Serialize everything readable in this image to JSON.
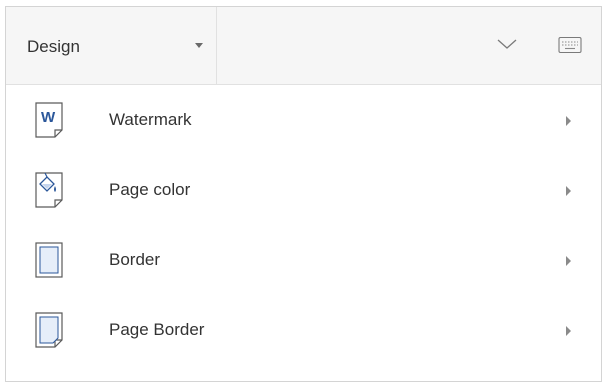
{
  "toolbar": {
    "tab_label": "Design",
    "collapse_icon": "chevron-down-icon",
    "keyboard_icon": "keyboard-icon"
  },
  "menu": {
    "items": [
      {
        "label": "Watermark",
        "icon": "watermark-icon"
      },
      {
        "label": "Page color",
        "icon": "page-color-icon"
      },
      {
        "label": "Border",
        "icon": "border-icon"
      },
      {
        "label": "Page Border",
        "icon": "page-border-icon"
      }
    ]
  },
  "colors": {
    "accent": "#2b579a",
    "icon_outline": "#5a5a5a",
    "toolbar_bg": "#f6f6f6"
  }
}
